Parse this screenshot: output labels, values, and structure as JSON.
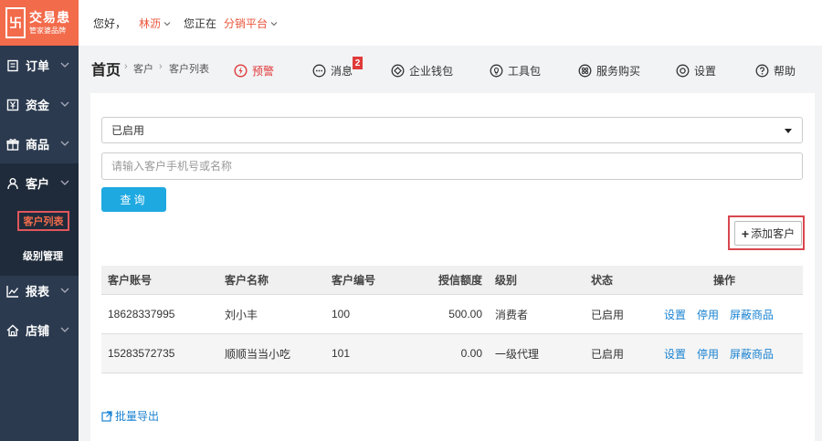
{
  "logo": {
    "mark": "卐",
    "name": "交易患",
    "tagline": "管家婆品牌"
  },
  "header": {
    "greeting": "您好，",
    "user": "林沥",
    "location_prefix": "您正在",
    "platform": "分销平台"
  },
  "sidebar": {
    "items": [
      {
        "label": "订单",
        "icon": "order-icon"
      },
      {
        "label": "资金",
        "icon": "yen-icon"
      },
      {
        "label": "商品",
        "icon": "gift-icon"
      },
      {
        "label": "客户",
        "icon": "user-icon"
      },
      {
        "label": "报表",
        "icon": "chart-icon"
      },
      {
        "label": "店铺",
        "icon": "home-icon"
      }
    ],
    "sub_items": [
      {
        "label": "客户列表"
      },
      {
        "label": "级别管理"
      }
    ]
  },
  "breadcrumb": {
    "home": "首页",
    "section": "客户",
    "page": "客户列表",
    "separator": "›"
  },
  "toolbar": {
    "warning": "预警",
    "messages": "消息",
    "messages_badge": "2",
    "wallet": "企业钱包",
    "toolkit": "工具包",
    "services": "服务购买",
    "settings": "设置",
    "help": "帮助"
  },
  "filters": {
    "status_value": "已启用",
    "search_placeholder": "请输入客户手机号或名称",
    "query_label": "查询"
  },
  "add_button": {
    "label": "添加客户"
  },
  "table": {
    "columns": [
      "客户账号",
      "客户名称",
      "客户编号",
      "授信额度",
      "级别",
      "状态",
      "操作"
    ],
    "rows": [
      {
        "account": "18628337995",
        "name": "刘小丰",
        "code": "100",
        "credit": "500.00",
        "level": "消费者",
        "status": "已启用",
        "ops": [
          "设置",
          "停用",
          "屏蔽商品"
        ]
      },
      {
        "account": "15283572735",
        "name": "顺顺当当小吃",
        "code": "101",
        "credit": "0.00",
        "level": "一级代理",
        "status": "已启用",
        "ops": [
          "设置",
          "停用",
          "屏蔽商品"
        ]
      }
    ]
  },
  "export": {
    "label": "批量导出"
  },
  "colors": {
    "brand": "#f26b4b",
    "sidebar": "#2b3a4f",
    "primary_button": "#1fa9e1",
    "link": "#1a82d1",
    "warning": "#e03a3a"
  }
}
